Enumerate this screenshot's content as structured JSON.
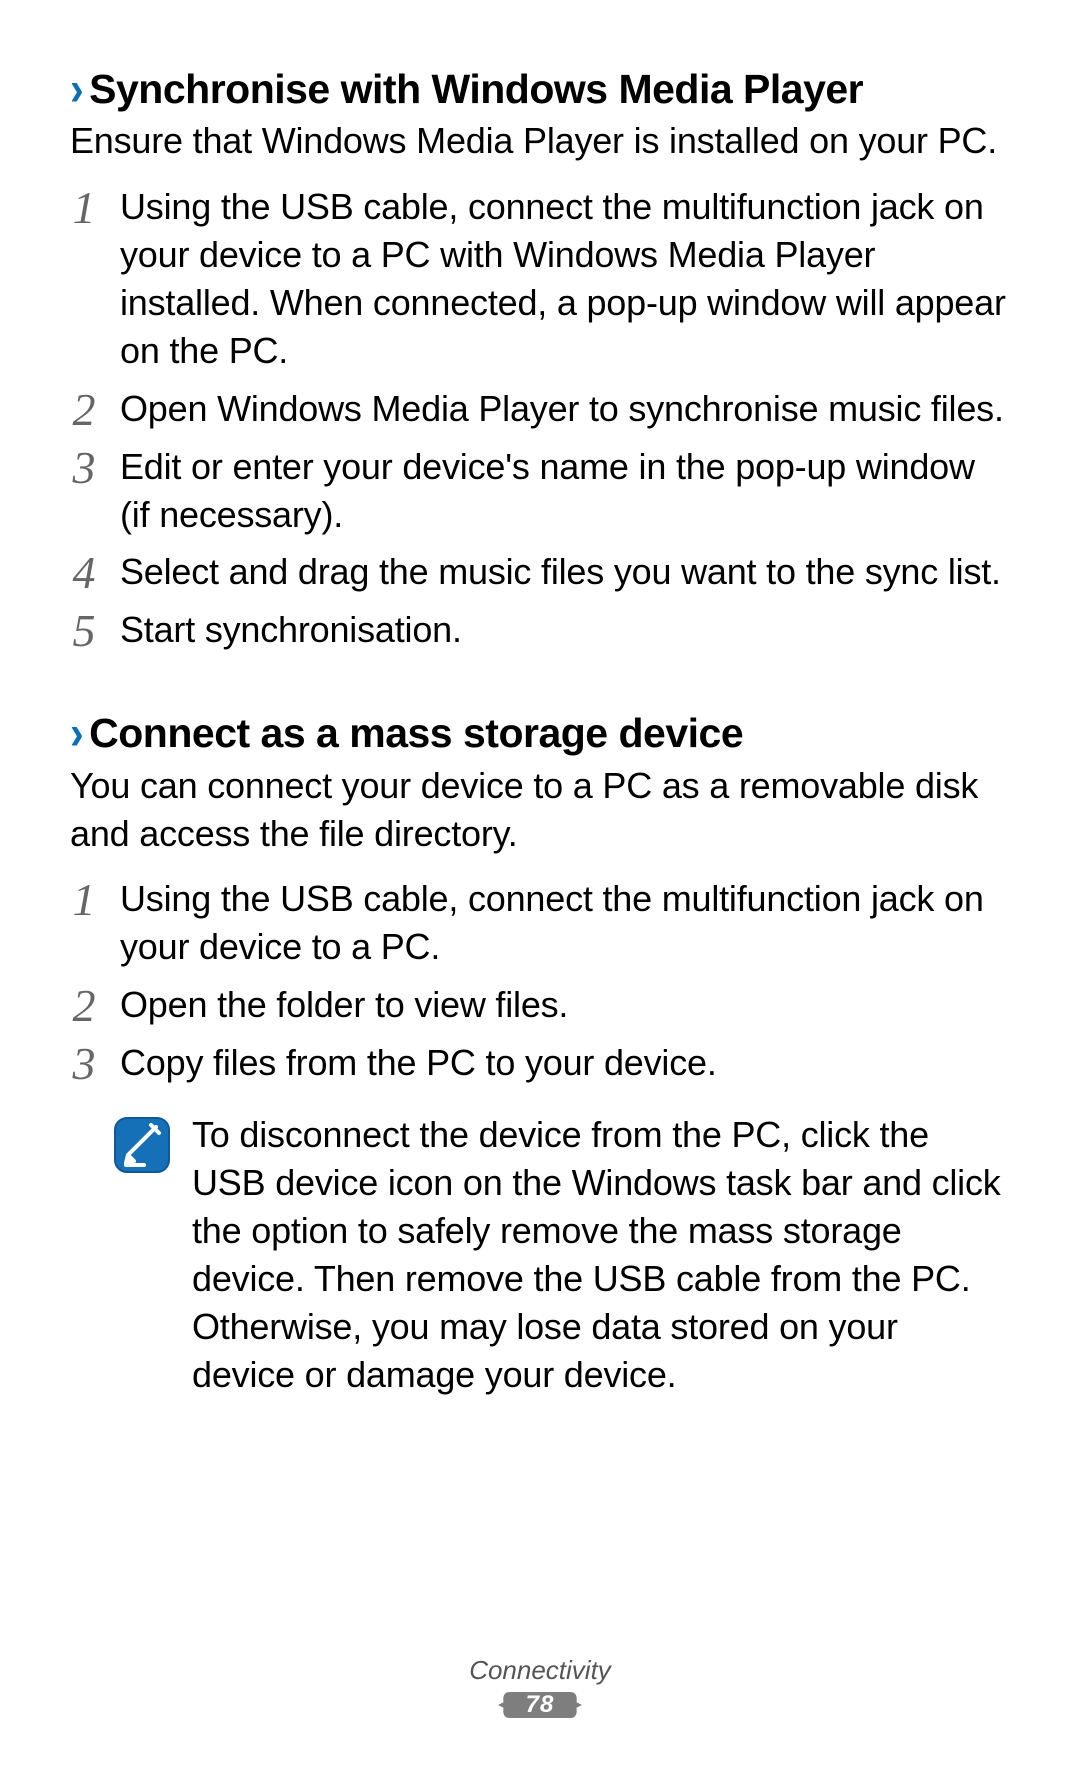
{
  "section1": {
    "title": "Synchronise with Windows Media Player",
    "intro": "Ensure that Windows Media Player is installed on your PC.",
    "steps": [
      "Using the USB cable, connect the multifunction jack on your device to a PC with Windows Media Player installed. When connected, a pop-up window will appear on the PC.",
      "Open Windows Media Player to synchronise music files.",
      "Edit or enter your device's name in the pop-up window (if necessary).",
      "Select and drag the music files you want to the sync list.",
      "Start synchronisation."
    ]
  },
  "section2": {
    "title": "Connect as a mass storage device",
    "intro": "You can connect your device to a PC as a removable disk and access the file directory.",
    "steps": [
      "Using the USB cable, connect the multifunction jack on your device to a PC.",
      "Open the folder to view files.",
      "Copy files from the PC to your device."
    ],
    "note": "To disconnect the device from the PC, click the USB device icon on the Windows task bar and click the option to safely remove the mass storage device. Then remove the USB cable from the PC. Otherwise, you may lose data stored on your device or damage your device."
  },
  "step_numbers": [
    "1",
    "2",
    "3",
    "4",
    "5"
  ],
  "footer": {
    "category": "Connectivity",
    "page": "78"
  },
  "icons": {
    "chevron": "›",
    "note": "note-icon"
  },
  "colors": {
    "accent_blue": "#1670b8",
    "step_gray": "#666666",
    "page_ribbon": "#7e7e7e"
  }
}
